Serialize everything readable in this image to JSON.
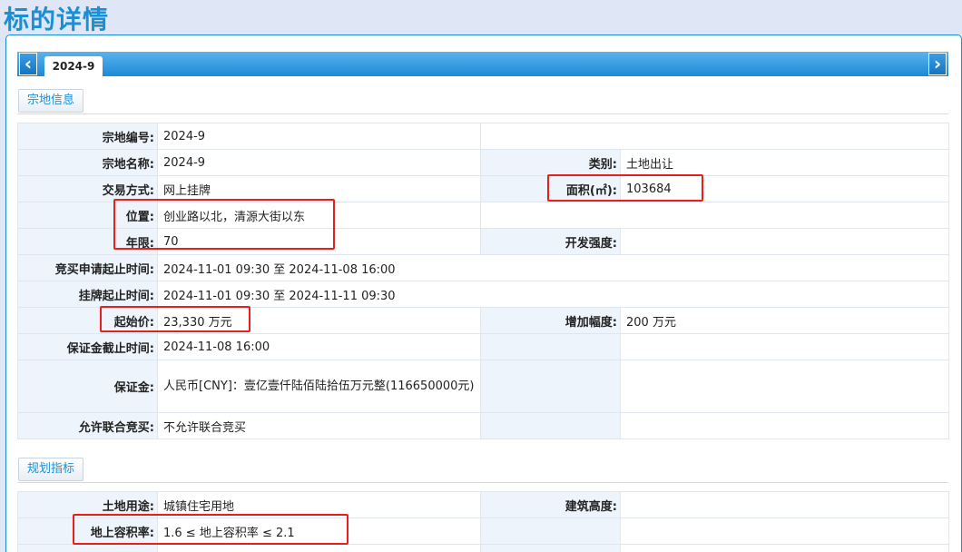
{
  "page_title": "标的详情",
  "tab": {
    "label": "2024-9"
  },
  "sections": {
    "land_info": "宗地信息",
    "planning": "规划指标"
  },
  "land": {
    "parcel_no_label": "宗地编号:",
    "parcel_no": "2024-9",
    "parcel_name_label": "宗地名称:",
    "parcel_name": "2024-9",
    "category_label": "类别:",
    "category": "土地出让",
    "trade_mode_label": "交易方式:",
    "trade_mode": "网上挂牌",
    "area_label": "面积(㎡):",
    "area": "103684",
    "location_label": "位置:",
    "location": "创业路以北，清源大街以东",
    "term_label": "年限:",
    "term": "70",
    "dev_intensity_label": "开发强度:",
    "dev_intensity": "",
    "apply_period_label": "竞买申请起止时间:",
    "apply_period": "2024-11-01 09:30 至 2024-11-08 16:00",
    "listing_period_label": "挂牌起止时间:",
    "listing_period": "2024-11-01 09:30 至 2024-11-11 09:30",
    "start_price_label": "起始价:",
    "start_price": "23,330 万元",
    "increment_label": "增加幅度:",
    "increment": "200 万元",
    "deposit_deadline_label": "保证金截止时间:",
    "deposit_deadline": "2024-11-08 16:00",
    "deposit_label": "保证金:",
    "deposit": "人民币[CNY]：壹亿壹仟陆佰陆拾伍万元整(116650000元)",
    "joint_bid_label": "允许联合竞买:",
    "joint_bid": "不允许联合竞买"
  },
  "planning": {
    "land_use_label": "土地用途:",
    "land_use": "城镇住宅用地",
    "building_height_label": "建筑高度:",
    "building_height": "",
    "far_label": "地上容积率:",
    "far": "1.6 ≤ 地上容积率 ≤ 2.1"
  },
  "colors": {
    "accent": "#1a8fd6",
    "highlight": "#e8201a",
    "label_bg": "#eef4fb"
  }
}
